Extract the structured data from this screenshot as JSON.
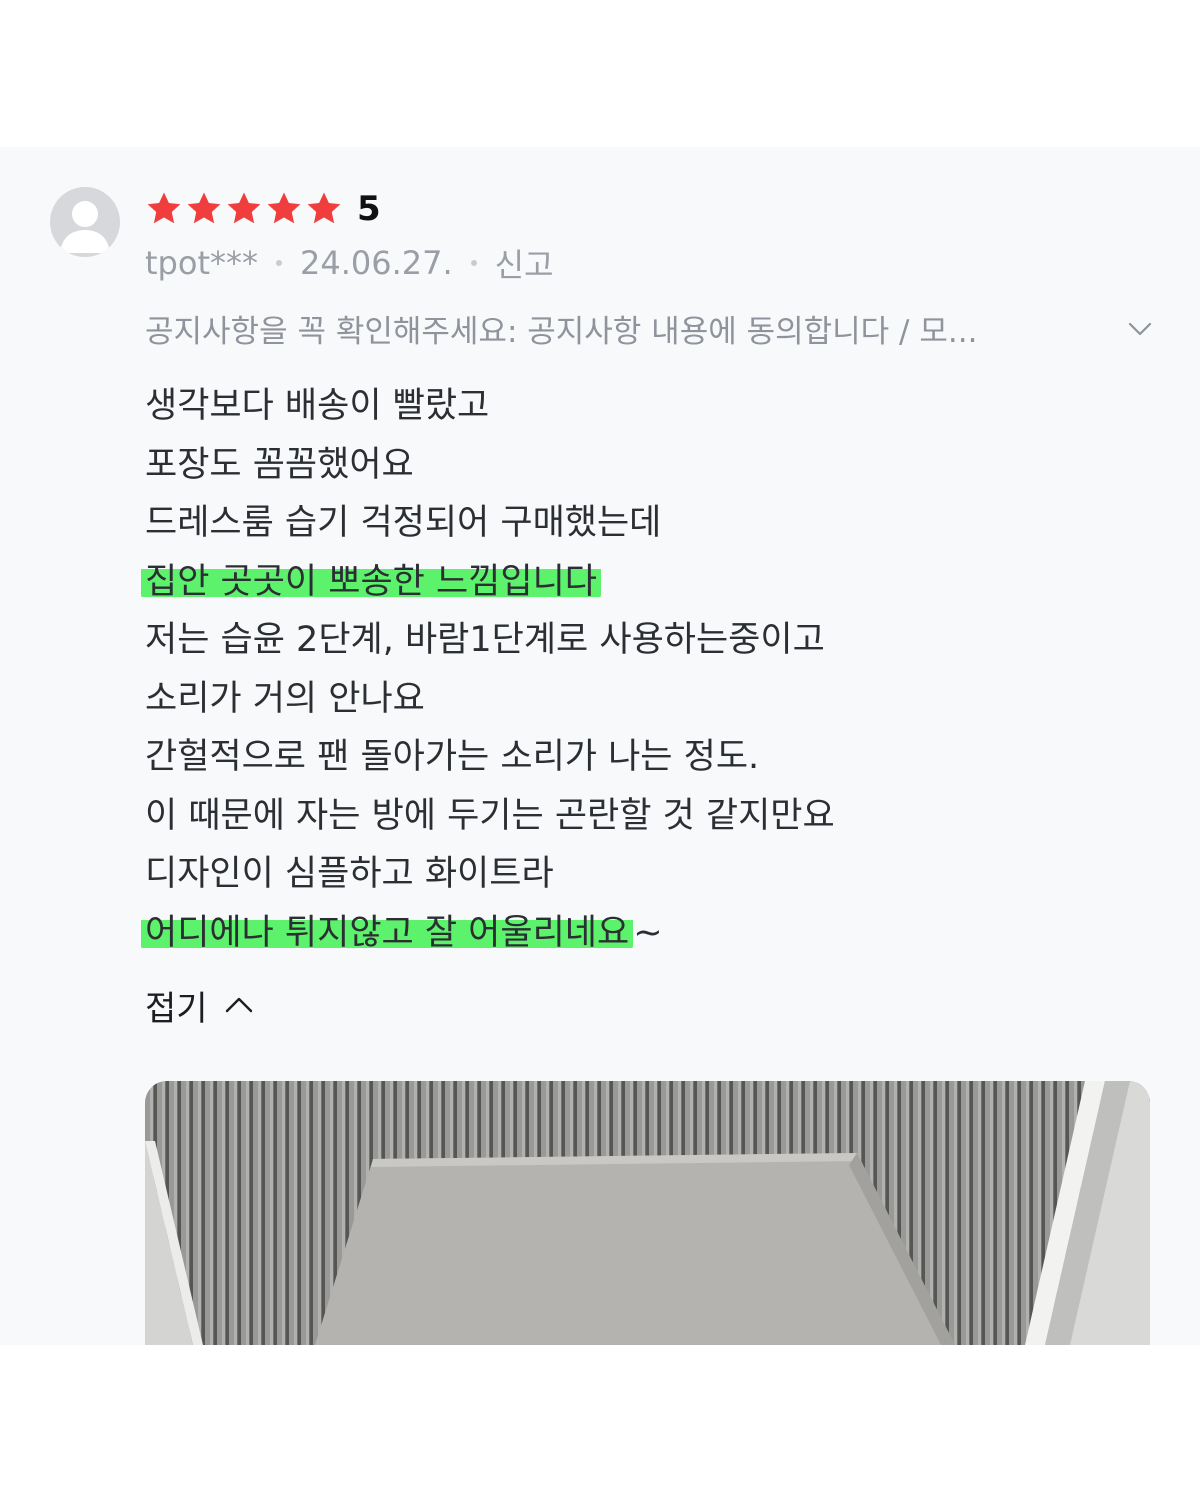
{
  "review": {
    "rating_score": "5",
    "stars": 5,
    "star_color": "#f03e3e",
    "user": "tpot***",
    "date": "24.06.27.",
    "report_label": "신고",
    "notice": "공지사항을 꼭 확인해주세요: 공지사항 내용에 동의합니다 / 모...",
    "highlight_color": "#5df26b",
    "lines": [
      "생각보다 배송이 빨랐고",
      "포장도 꼼꼼했어요",
      "드레스룸 습기 걱정되어 구매했는데",
      "집안 곳곳이 뽀송한 느낌입니다",
      "저는 습윤 2단계, 바람1단계로 사용하는중이고",
      "소리가 거의 안나요",
      "간헐적으로 팬 돌아가는 소리가 나는 정도.",
      "이 때문에 자는 방에 두기는 곤란할 것 같지만요",
      "디자인이 심플하고 화이트라",
      "어디에나 튀지않고 잘 어울리네요"
    ],
    "last_line_suffix": "~",
    "fold_label": "접기"
  }
}
